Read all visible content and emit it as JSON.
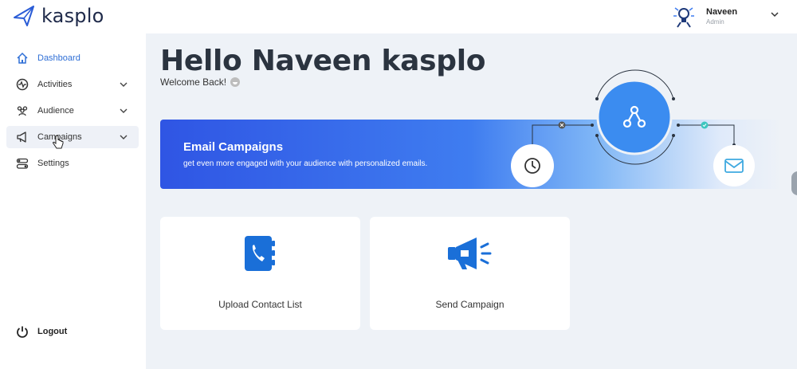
{
  "brand": {
    "name": "kasplo",
    "color": "#1f2a4a"
  },
  "user": {
    "name": "Naveen",
    "role": "Admin",
    "avatar_icon": "bulb-person-icon",
    "menu_icon": "chevron-down-icon"
  },
  "sidebar": {
    "items": [
      {
        "label": "Dashboard",
        "icon": "home-icon",
        "expandable": false,
        "active": true
      },
      {
        "label": "Activities",
        "icon": "activity-icon",
        "expandable": true
      },
      {
        "label": "Audience",
        "icon": "users-icon",
        "expandable": true
      },
      {
        "label": "Campaigns",
        "icon": "megaphone-icon",
        "expandable": true,
        "hovered": true
      },
      {
        "label": "Settings",
        "icon": "toggles-icon",
        "expandable": false
      }
    ],
    "logout_label": "Logout"
  },
  "main": {
    "greeting": "Hello Naveen kasplo",
    "welcome": "Welcome Back!",
    "banner": {
      "title": "Email Campaigns",
      "subtitle": "get even more engaged with your audience with personalized emails."
    },
    "cards": [
      {
        "label": "Upload Contact List",
        "icon": "contact-book-icon"
      },
      {
        "label": "Send Campaign",
        "icon": "megaphone-icon"
      }
    ]
  },
  "colors": {
    "accent": "#2f6fd6",
    "banner_start": "#2f55e4",
    "icon_blue": "#1a6fd8"
  }
}
